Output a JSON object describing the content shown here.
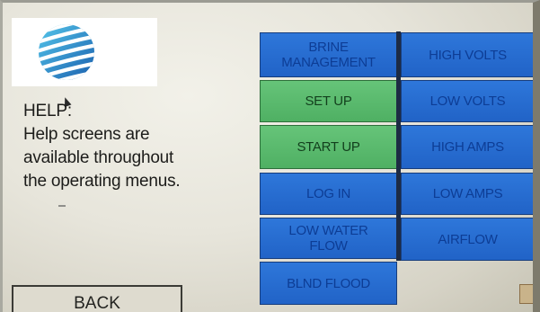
{
  "help": {
    "heading": "HELP:",
    "lines": [
      "Help screens are",
      "available throughout",
      "the operating menus."
    ]
  },
  "buttons": {
    "left": [
      {
        "label": "BRINE MANAGEMENT",
        "color": "#2e77da"
      },
      {
        "label": "SET UP",
        "color": "#5fbe72"
      },
      {
        "label": "START UP",
        "color": "#5fbe72"
      },
      {
        "label": "LOG IN",
        "color": "#2e77da"
      },
      {
        "label": "LOW WATER FLOW",
        "color": "#2e77da"
      },
      {
        "label": "BLND FLOOD",
        "color": "#2e77da"
      }
    ],
    "right": [
      {
        "label": "HIGH VOLTS",
        "color": "#2e77da"
      },
      {
        "label": "LOW VOLTS",
        "color": "#2e77da"
      },
      {
        "label": "HIGH AMPS",
        "color": "#2e77da"
      },
      {
        "label": "LOW AMPS",
        "color": "#2e77da"
      },
      {
        "label": "AIRFLOW",
        "color": "#2e77da"
      }
    ]
  },
  "back": {
    "label": "BACK"
  },
  "logo": {
    "icon": "globe-logo-icon",
    "colors": [
      "#2aa8d8",
      "#1d6fb8"
    ]
  }
}
